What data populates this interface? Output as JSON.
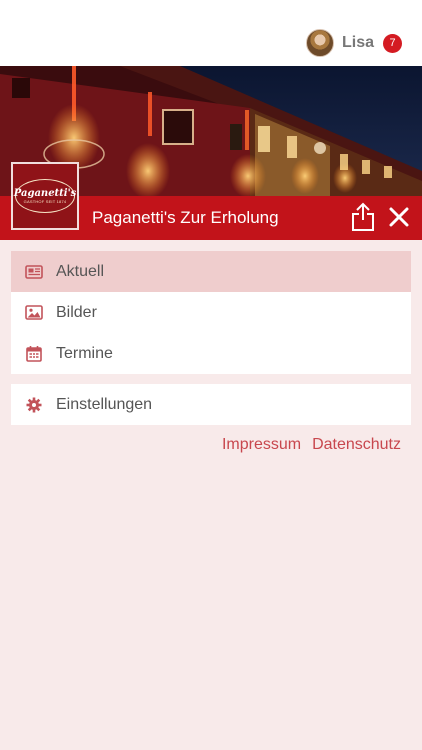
{
  "header": {
    "username": "Lisa",
    "notification_count": "7"
  },
  "venue": {
    "title": "Paganetti's Zur Erholung",
    "logo_text": "Paganetti's",
    "logo_subtext": "GASTHOF SEIT 1874"
  },
  "nav": {
    "items": [
      {
        "label": "Aktuell",
        "icon": "newspaper-icon",
        "active": true
      },
      {
        "label": "Bilder",
        "icon": "image-icon",
        "active": false
      },
      {
        "label": "Termine",
        "icon": "calendar-icon",
        "active": false
      }
    ]
  },
  "settings": {
    "label": "Einstellungen",
    "icon": "gear-icon"
  },
  "footer": {
    "impressum": "Impressum",
    "datenschutz": "Datenschutz"
  },
  "colors": {
    "brand_red": "#c2131a",
    "active_row": "#efcdcd",
    "background": "#f8eaea",
    "link": "#c8474e",
    "icon": "#c2535a"
  }
}
